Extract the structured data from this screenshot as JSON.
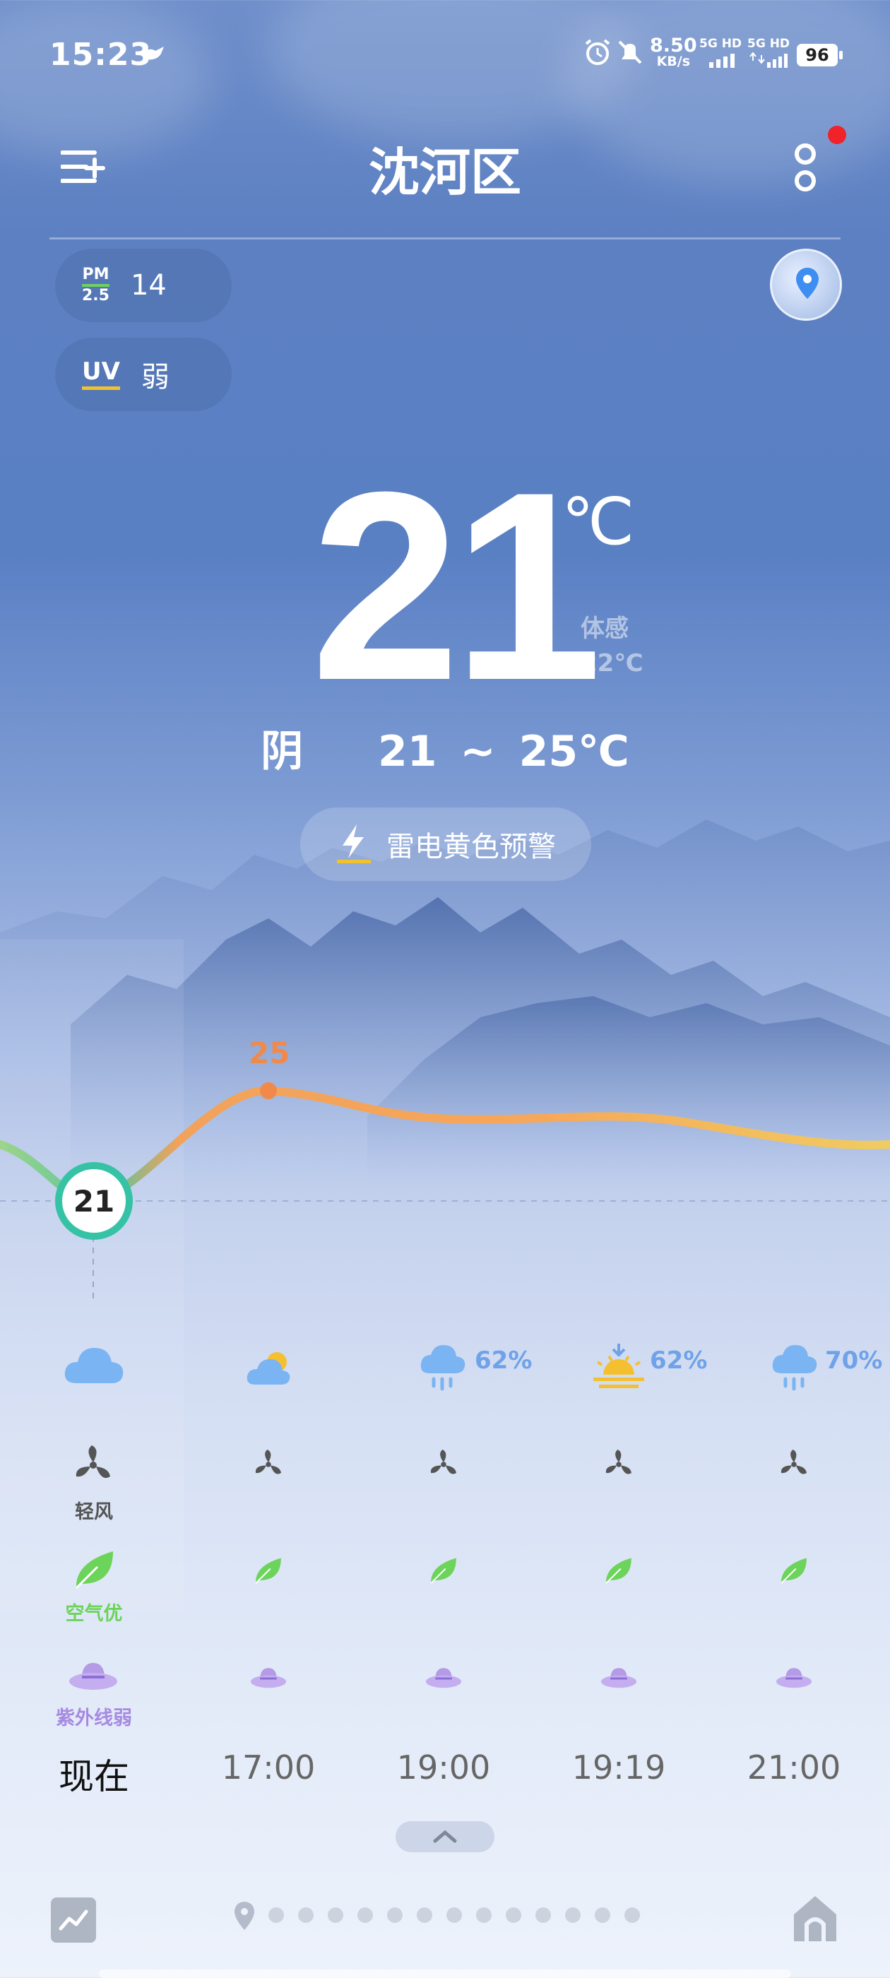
{
  "status_bar": {
    "time": "15:23",
    "net_speed": "8.50",
    "net_unit": "KB/s",
    "sig1": "5G HD",
    "sig2": "5G HD",
    "battery": "96"
  },
  "header": {
    "city": "沈河区"
  },
  "badges": {
    "pm_label_top": "PM",
    "pm_label_bottom": "2.5",
    "pm_value": "14",
    "uv_label": "UV",
    "uv_value": "弱"
  },
  "current": {
    "temp": "21",
    "unit": "℃",
    "feels_label": "体感",
    "feels_value": "22℃",
    "condition": "阴",
    "range": "21 ~ 25℃"
  },
  "alert": {
    "text": "雷电黄色预警"
  },
  "hourly": {
    "max_label": "25",
    "now_temp": "21",
    "columns": [
      {
        "time": "现在",
        "weather_icon": "cloudy-icon",
        "precip": "",
        "wind": "轻风",
        "air": "空气优",
        "uv": "紫外线弱"
      },
      {
        "time": "17:00",
        "weather_icon": "partly-cloudy-icon",
        "precip": "",
        "wind": "",
        "air": "",
        "uv": ""
      },
      {
        "time": "19:00",
        "weather_icon": "rain-icon",
        "precip": "62%",
        "wind": "",
        "air": "",
        "uv": ""
      },
      {
        "time": "19:19",
        "weather_icon": "sunset-icon",
        "precip": "62%",
        "wind": "",
        "air": "",
        "uv": ""
      },
      {
        "time": "21:00",
        "weather_icon": "rain-icon",
        "precip": "70%",
        "wind": "",
        "air": "",
        "uv": ""
      }
    ]
  },
  "colors": {
    "accent_now": "#35c2a5",
    "max_point": "#f08a4b",
    "precip": "#6fa2e8",
    "air_good": "#6cd45a",
    "uv": "#b59ae6",
    "temp_curve_warm": "#f0a050"
  }
}
